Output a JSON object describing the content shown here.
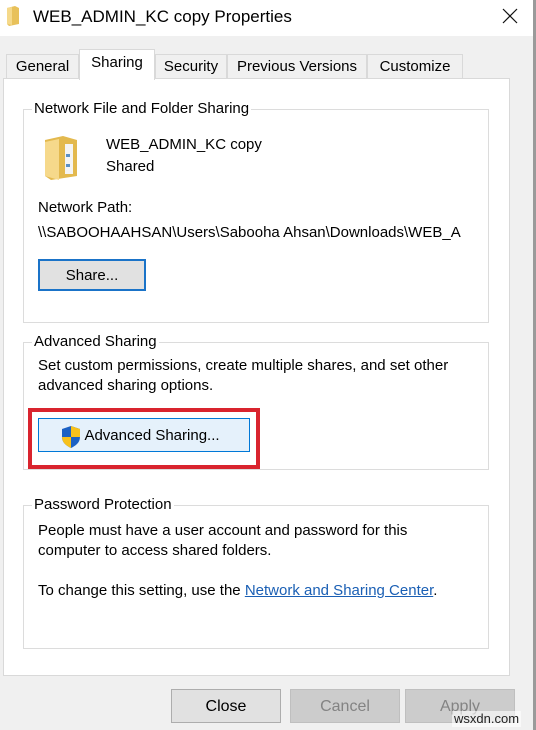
{
  "window": {
    "title": "WEB_ADMIN_KC copy Properties",
    "close_icon": "close-icon"
  },
  "tabs": [
    {
      "label": "General",
      "active": false
    },
    {
      "label": "Sharing",
      "active": true
    },
    {
      "label": "Security",
      "active": false
    },
    {
      "label": "Previous Versions",
      "active": false
    },
    {
      "label": "Customize",
      "active": false
    }
  ],
  "network_sharing": {
    "group_label": "Network File and Folder Sharing",
    "folder_name": "WEB_ADMIN_KC copy",
    "status": "Shared",
    "path_label": "Network Path:",
    "path_value": "\\\\SABOOHAAHSAN\\Users\\Sabooha Ahsan\\Downloads\\WEB_A",
    "share_button": "Share..."
  },
  "advanced_sharing": {
    "group_label": "Advanced Sharing",
    "description_line1": "Set custom permissions, create multiple shares, and set other",
    "description_line2": "advanced sharing options.",
    "button_label": "Advanced Sharing...",
    "highlight_color": "#d9242e"
  },
  "password_protection": {
    "group_label": "Password Protection",
    "line1": "People must have a user account and password for this",
    "line2": "computer to access shared folders.",
    "change_prefix": "To change this setting, use the ",
    "link_text": "Network and Sharing Center",
    "change_suffix": "."
  },
  "footer": {
    "close": "Close",
    "cancel": "Cancel",
    "apply": "Apply"
  },
  "watermark": "wsxdn.com"
}
